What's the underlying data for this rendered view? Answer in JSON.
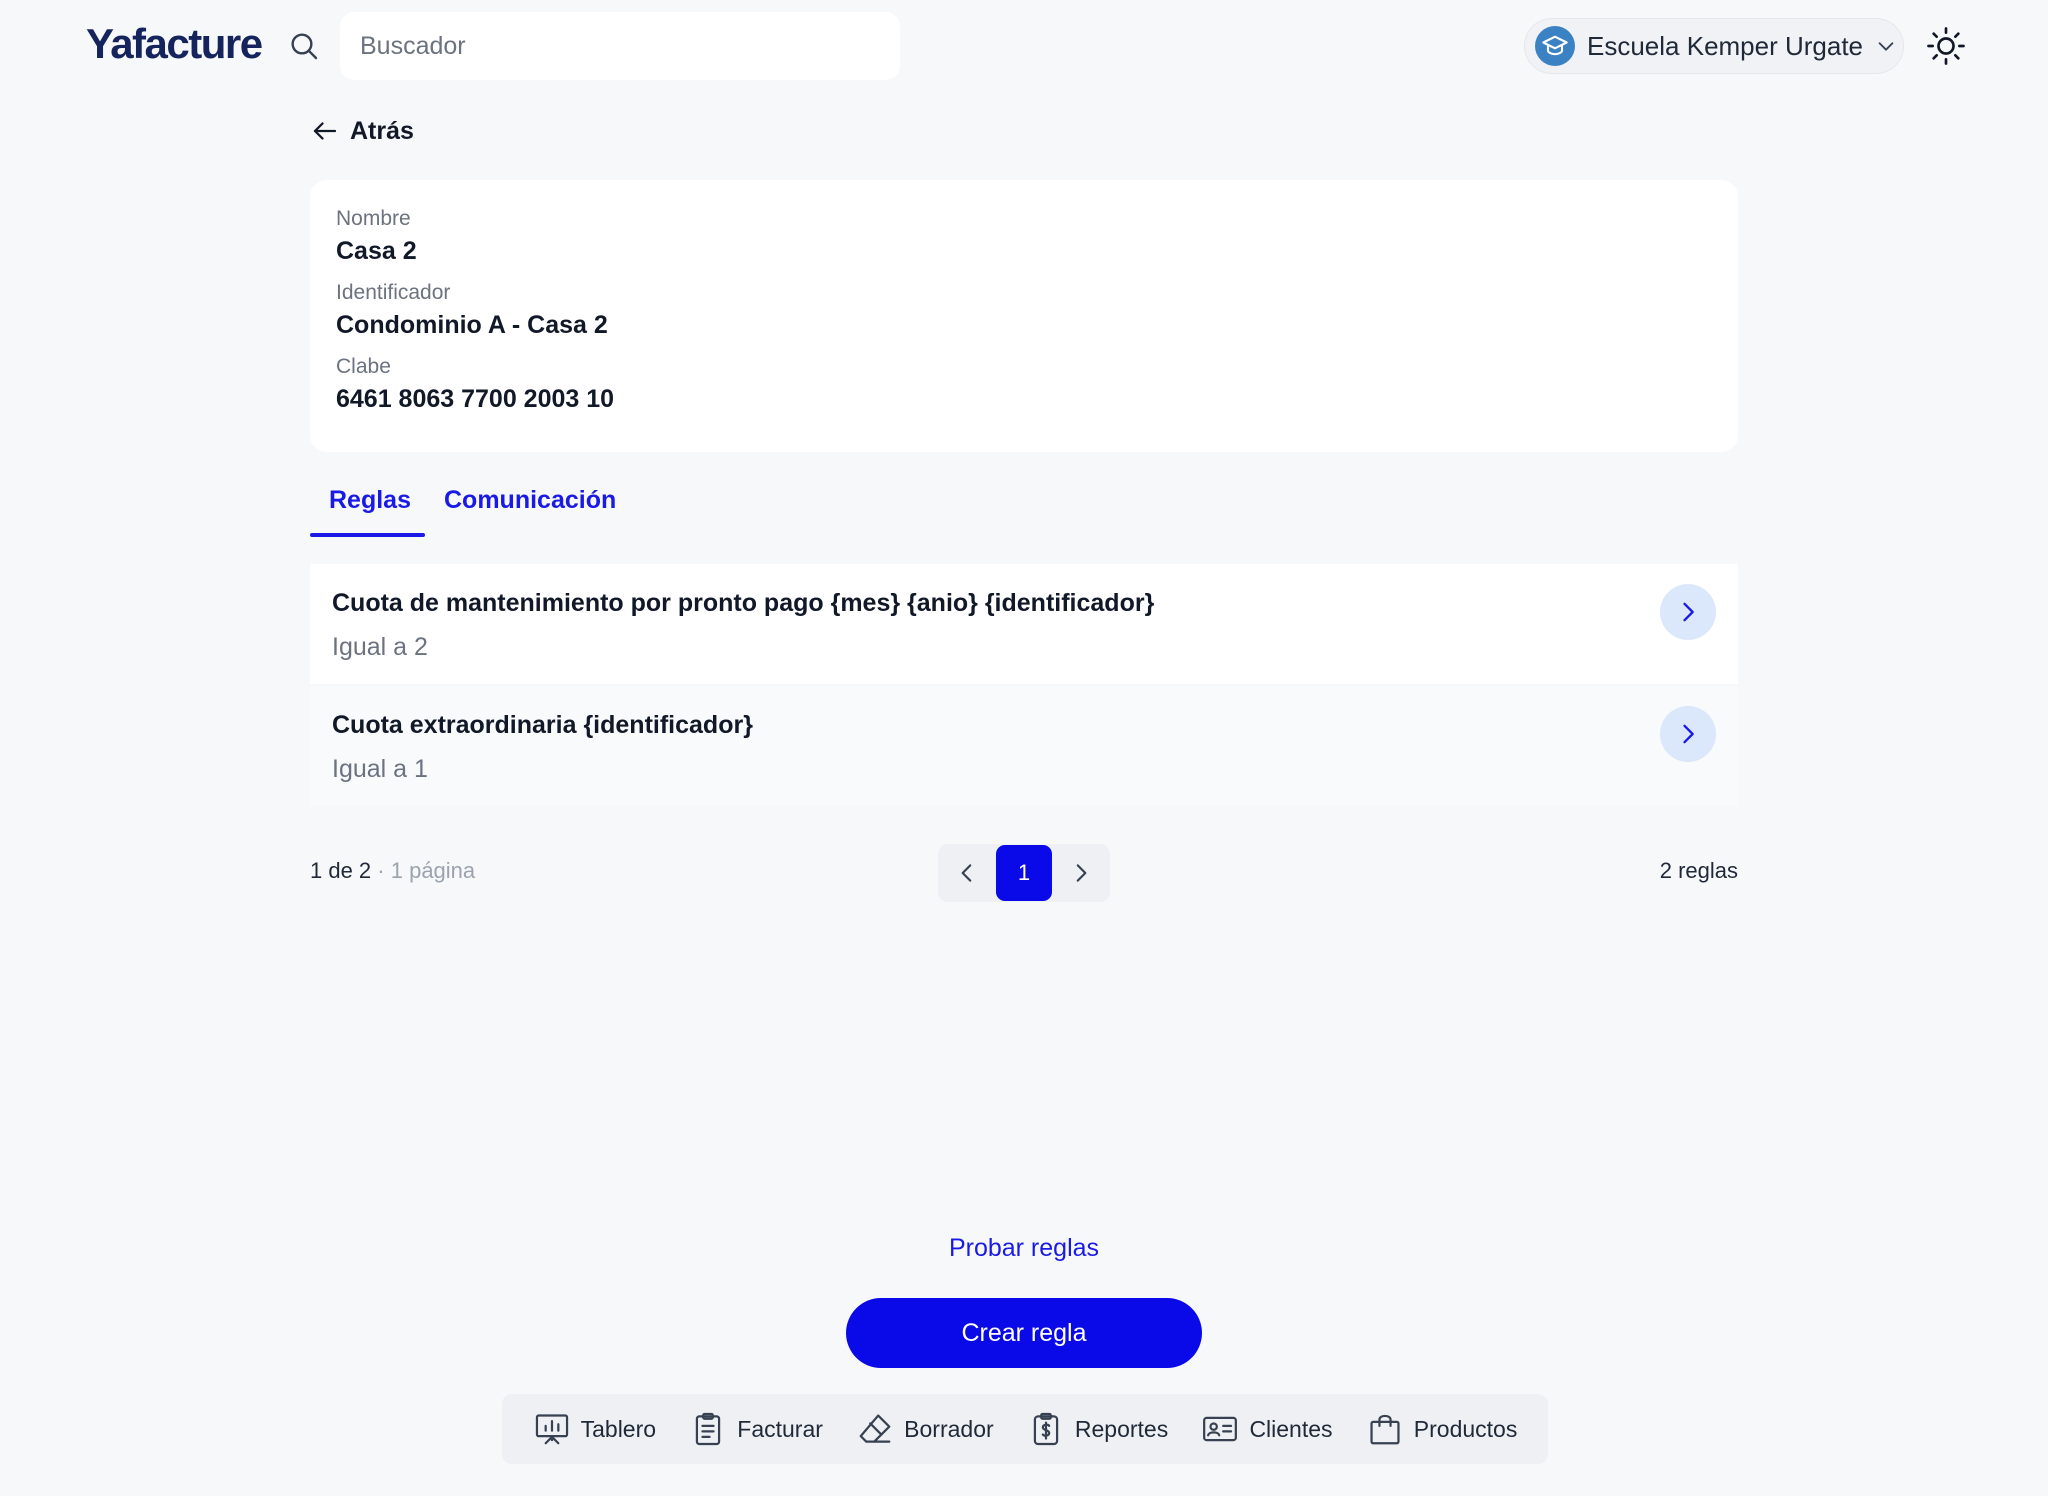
{
  "header": {
    "logo": "Yafacture",
    "search_placeholder": "Buscador",
    "organization": "Escuela Kemper Urgate"
  },
  "back_label": "Atrás",
  "details": {
    "name_label": "Nombre",
    "name_value": "Casa 2",
    "identifier_label": "Identificador",
    "identifier_value": "Condominio A - Casa 2",
    "clabe_label": "Clabe",
    "clabe_value": "6461 8063 7700 2003 10"
  },
  "tabs": [
    {
      "label": "Reglas",
      "active": true
    },
    {
      "label": "Comunicación",
      "active": false
    }
  ],
  "rules": [
    {
      "title": "Cuota de mantenimiento por pronto pago {mes} {anio} {identificador}",
      "subtitle": "Igual a 2"
    },
    {
      "title": "Cuota extraordinaria {identificador}",
      "subtitle": "Igual a 1"
    }
  ],
  "pagination": {
    "range": "1 de 2",
    "pages": "· 1 página",
    "current_page": "1",
    "total": "2 reglas"
  },
  "actions": {
    "test_rules": "Probar reglas",
    "create_rule": "Crear regla"
  },
  "bottom_nav": [
    {
      "label": "Tablero",
      "icon": "presentation-chart-icon"
    },
    {
      "label": "Facturar",
      "icon": "clipboard-icon"
    },
    {
      "label": "Borrador",
      "icon": "eraser-icon"
    },
    {
      "label": "Reportes",
      "icon": "money-report-icon"
    },
    {
      "label": "Clientes",
      "icon": "id-card-icon"
    },
    {
      "label": "Productos",
      "icon": "shopping-bag-icon"
    }
  ],
  "colors": {
    "accent": "#0a0ae8",
    "link": "#1a1ae6",
    "logo": "#15245c",
    "background": "#f7f8fa"
  }
}
